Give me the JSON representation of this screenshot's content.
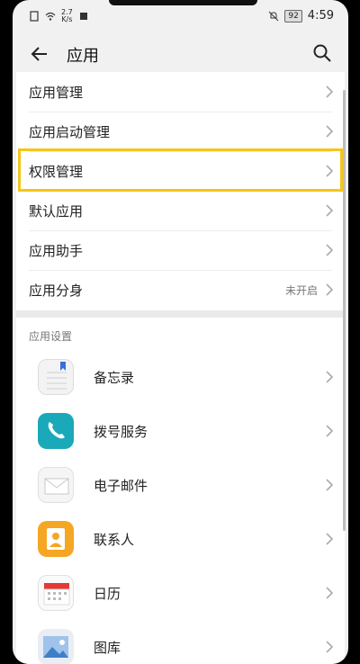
{
  "status_bar": {
    "network_speed_value": "2.7",
    "network_speed_unit": "K/s",
    "battery": "92",
    "time": "4:59"
  },
  "toolbar": {
    "title": "应用"
  },
  "menu_items": [
    {
      "label": "应用管理",
      "value": ""
    },
    {
      "label": "应用启动管理",
      "value": ""
    },
    {
      "label": "权限管理",
      "value": ""
    },
    {
      "label": "默认应用",
      "value": ""
    },
    {
      "label": "应用助手",
      "value": ""
    },
    {
      "label": "应用分身",
      "value": "未开启"
    }
  ],
  "app_settings": {
    "section_title": "应用设置",
    "apps": [
      {
        "label": "备忘录",
        "icon": "notes-icon"
      },
      {
        "label": "拨号服务",
        "icon": "phone-icon"
      },
      {
        "label": "电子邮件",
        "icon": "mail-icon"
      },
      {
        "label": "联系人",
        "icon": "contacts-icon"
      },
      {
        "label": "日历",
        "icon": "calendar-icon"
      },
      {
        "label": "图库",
        "icon": "gallery-icon"
      }
    ]
  },
  "colors": {
    "highlight": "#f5c518",
    "phone_icon_bg": "#1aa9b9",
    "contacts_icon_bg": "#f5a623",
    "calendar_accent": "#e53935"
  }
}
